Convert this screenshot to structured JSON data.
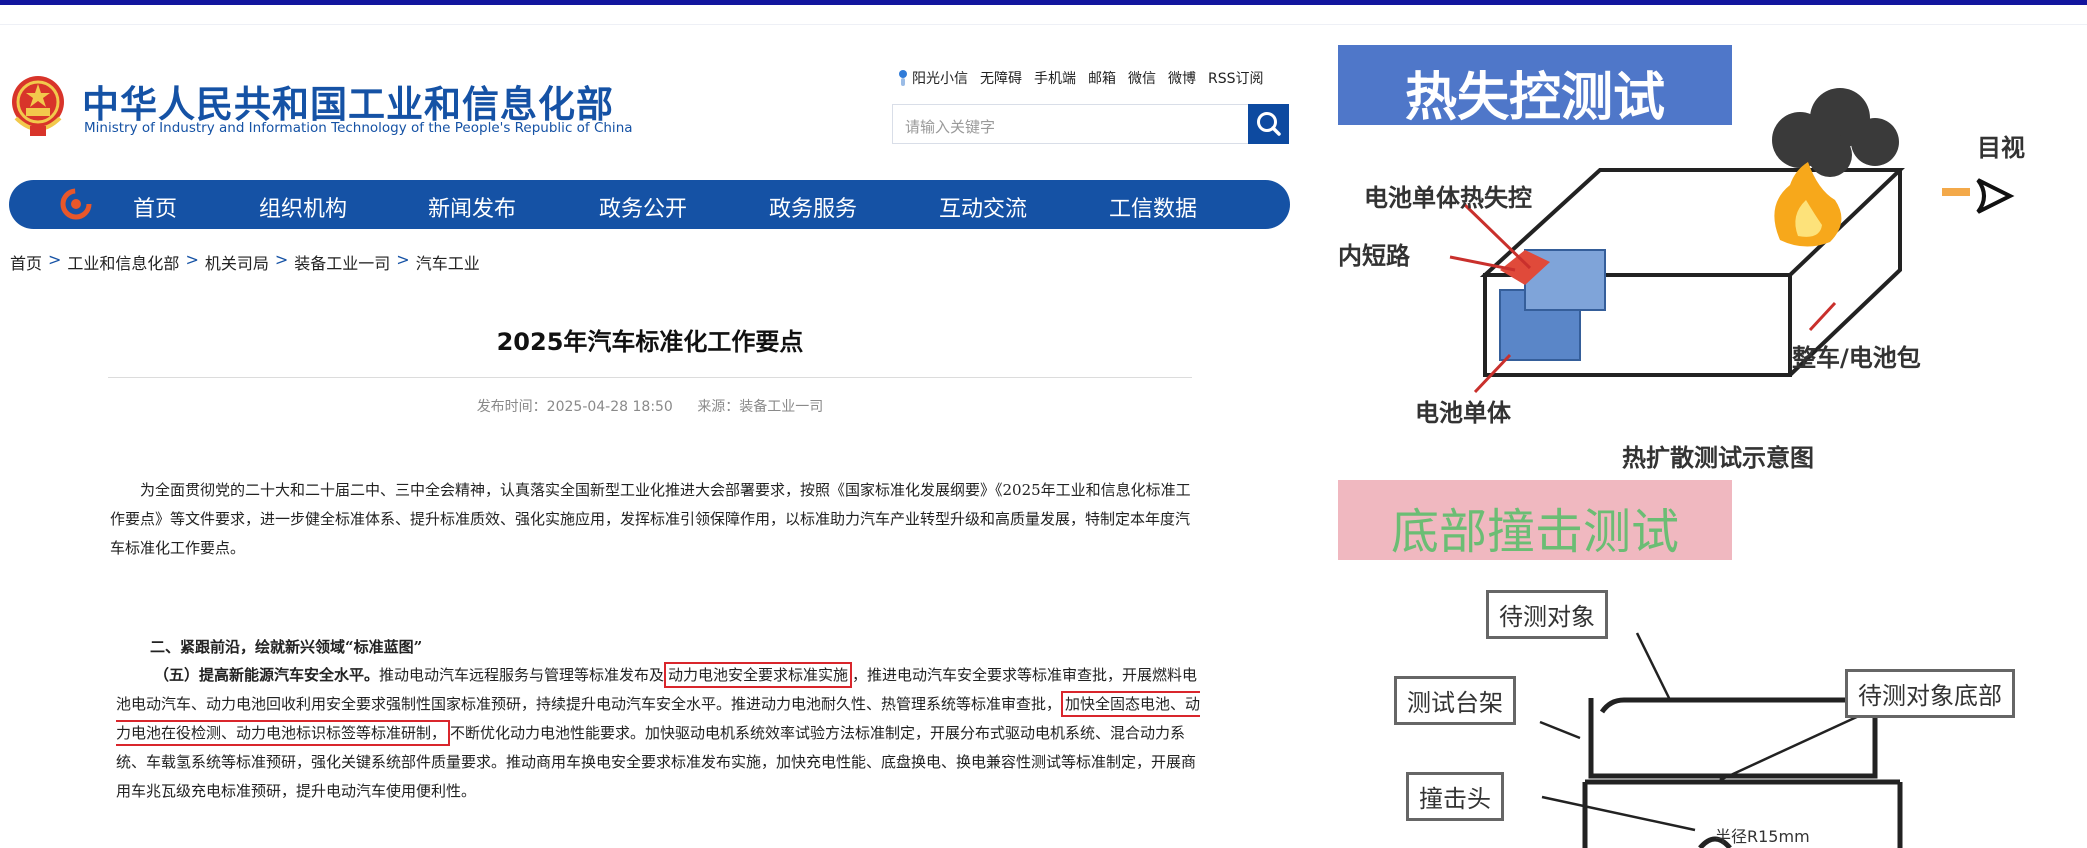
{
  "header": {
    "logo_cn": "中华人民共和国工业和信息化部",
    "logo_en": "Ministry of Industry and Information Technology of the People's Republic of China",
    "quick_links": [
      "阳光小信",
      "无障碍",
      "手机端",
      "邮箱",
      "微信",
      "微博",
      "RSS订阅"
    ],
    "search_placeholder": "请输入关键字"
  },
  "nav": [
    "首页",
    "组织机构",
    "新闻发布",
    "政务公开",
    "政务服务",
    "互动交流",
    "工信数据"
  ],
  "breadcrumb": [
    "首页",
    "工业和信息化部",
    "机关司局",
    "装备工业一司",
    "汽车工业"
  ],
  "breadcrumb_sep": ">",
  "article": {
    "title": "2025年汽车标准化工作要点",
    "publish_time": "发布时间：2025-04-28 18:50",
    "source": "来源：装备工业一司",
    "intro": "为全面贯彻党的二十大和二十届二中、三中全会精神，认真落实全国新型工业化推进大会部署要求，按照《国家标准化发展纲要》《2025年工业和信息化标准工作要点》等文件要求，进一步健全标准体系、提升标准质效、强化实施应用，发挥标准引领保障作用，以标准助力汽车产业转型升级和高质量发展，特制定本年度汽车标准化工作要点。",
    "section_heading": "二、紧跟前沿，绘就新兴领域“标准蓝图”",
    "para_lead": "（五）提高新能源汽车安全水平。",
    "para_a": "推动电动汽车远程服务与管理等标准发布及",
    "highlight_1": "动力电池安全要求标准实施",
    "para_b": "，推进电动汽车安全要求等标准审查批，开展燃料电池电动汽车、动力电池回收利用安全要求强制性国家标准预研，持续提升电动汽车安全水平。推进动力电池耐久性、热管理系统等标准审查批，",
    "highlight_2": "加快全固态电池、动力电池在役检测、动力电池标识标签等标准研制，",
    "para_c": "不断优化动力电池性能要求。加快驱动电机系统效率试验方法标准制定，开展分布式驱动电机系统、混合动力系统、车载氢系统等标准预研，强化关键系统部件质量要求。推动商用车换电安全要求标准发布实施，加快充电性能、底盘换电、换电兼容性测试等标准制定，开展商用车兆瓦级充电标准预研，提升电动汽车使用便利性。"
  },
  "figure": {
    "banner_thermal": "热失控测试",
    "label_cell_runaway": "电池单体热失控",
    "label_short": "内短路",
    "label_visual": "目视",
    "label_pack": "整车/电池包",
    "label_cell": "电池单体",
    "caption_thermal": "热扩散测试示意图",
    "banner_bottom": "底部撞击测试",
    "label_object": "待测对象",
    "label_rig": "测试台架",
    "label_object_bottom": "待测对象底部",
    "label_head": "撞击头",
    "label_radius": "半径R15mm"
  },
  "colors": {
    "brand_blue": "#1552a5",
    "highlight_red": "#d9262c",
    "banner_blue": "#4f77c9",
    "banner_pink": "#f0b8c0"
  }
}
